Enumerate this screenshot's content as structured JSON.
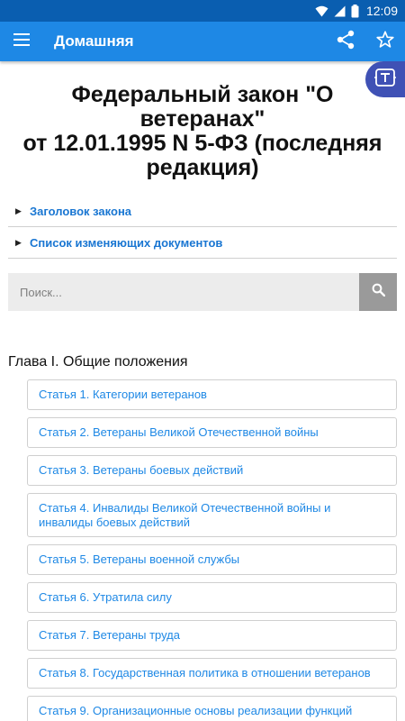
{
  "status_bar": {
    "time": "12:09"
  },
  "app_bar": {
    "title": "Домашняя",
    "icons": [
      "menu-icon",
      "share-icon",
      "star-icon"
    ]
  },
  "floating_button": {
    "icon": "text-format-icon"
  },
  "document": {
    "title_line1": "Федеральный закон \"О ветеранах\"",
    "title_line2": "от 12.01.1995 N 5-ФЗ (последняя редакция)"
  },
  "sections": [
    {
      "label": "Заголовок закона"
    },
    {
      "label": "Список изменяющих документов"
    }
  ],
  "search": {
    "placeholder": "Поиск...",
    "icon": "search-icon"
  },
  "chapter": {
    "heading": "Глава I. Общие положения",
    "articles": [
      {
        "label": "Статья 1. Категории ветеранов"
      },
      {
        "label": "Статья 2. Ветераны Великой Отечественной войны"
      },
      {
        "label": "Статья 3. Ветераны боевых действий"
      },
      {
        "label": "Статья 4. Инвалиды Великой Отечественной войны и инвалиды боевых действий"
      },
      {
        "label": "Статья 5. Ветераны военной службы"
      },
      {
        "label": "Статья 6. Утратила силу"
      },
      {
        "label": "Статья 7. Ветераны труда"
      },
      {
        "label": "Статья 8. Государственная политика в отношении ветеранов"
      },
      {
        "label": "Статья 9. Организационные основы реализации функций"
      }
    ]
  },
  "colors": {
    "status_bar": "#0a5eb0",
    "app_bar": "#1e88e5",
    "fab": "#3f51b5",
    "link": "#1e88e5",
    "search_button": "#9a9a9a"
  }
}
